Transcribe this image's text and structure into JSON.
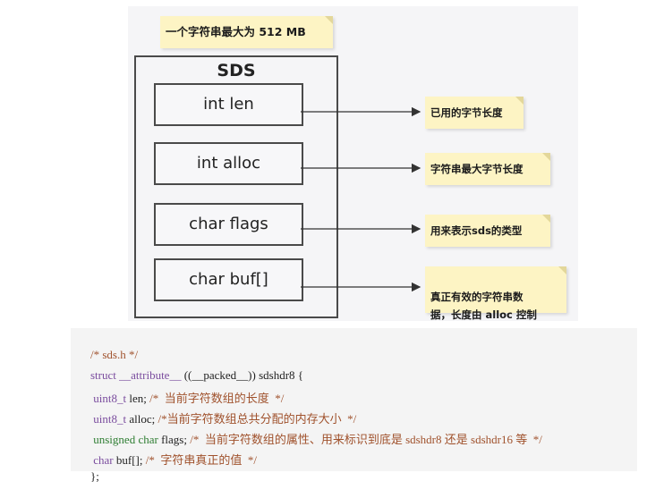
{
  "diagram": {
    "title_note": "一个字符串最大为 512 MB",
    "struct_title": "SDS",
    "fields": [
      "int len",
      "int alloc",
      "char flags",
      "char buf[]"
    ],
    "notes": [
      "已用的字节长度",
      "字符串最大字节长度",
      "用来表示sds的类型",
      "真正有效的字符串数\n据，长度由 alloc 控制"
    ],
    "note_color": "#fdf4c4"
  },
  "code": {
    "line1": "/* sds.h */",
    "line2_kw": "struct __attribute__",
    "line2_rest": " ((__packed__)) sdshdr8 {",
    "line3_type": "uint8_t",
    "line3_rest": " len; ",
    "line3_cm": "/*  当前字符数组的长度  */",
    "line4_type": "uint8_t",
    "line4_rest": " alloc; ",
    "line4_cm": "/*当前字符数组总共分配的内存大小  */",
    "line5_type": "unsigned char",
    "line5_rest": " flags; ",
    "line5_cm": "/*  当前字符数组的属性、用来标识到底是 sdshdr8 还是 sdshdr16 等  */",
    "line6_type": "char",
    "line6_rest": " buf[]; ",
    "line6_cm": "/*  字符串真正的值  */",
    "line7": "};"
  }
}
